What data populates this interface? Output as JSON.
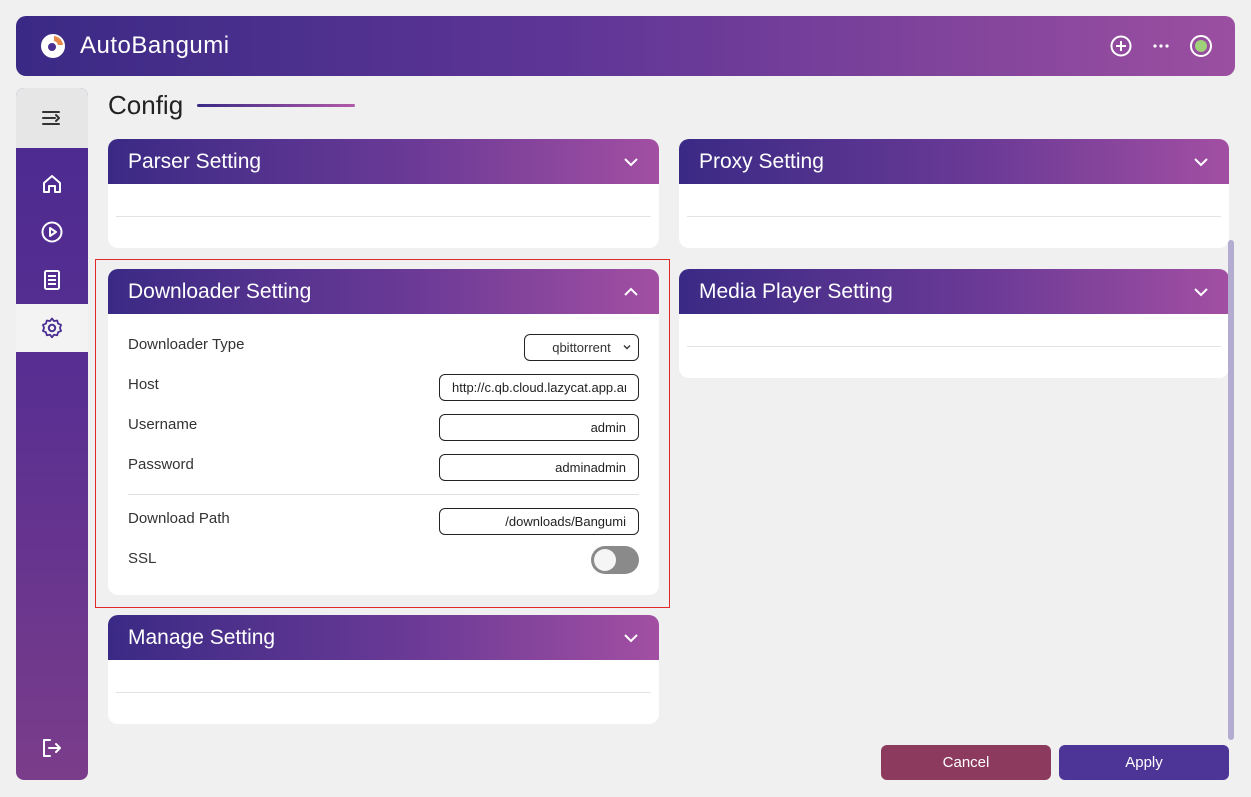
{
  "app": {
    "title": "AutoBangumi"
  },
  "page": {
    "title": "Config"
  },
  "sidebar": {
    "items": [
      {
        "icon": "home-icon",
        "label": "Home"
      },
      {
        "icon": "play-icon",
        "label": "Player"
      },
      {
        "icon": "log-icon",
        "label": "Log"
      },
      {
        "icon": "gear-icon",
        "label": "Config",
        "active": true
      }
    ],
    "logout_icon": "logout-icon"
  },
  "cards": {
    "parser": {
      "title": "Parser Setting"
    },
    "proxy": {
      "title": "Proxy Setting"
    },
    "downloader": {
      "title": "Downloader Setting",
      "fields": {
        "type_label": "Downloader Type",
        "type_value": "qbittorrent",
        "host_label": "Host",
        "host_value": "http://c.qb.cloud.lazycat.app.ar",
        "username_label": "Username",
        "username_value": "admin",
        "password_label": "Password",
        "password_value": "adminadmin",
        "path_label": "Download Path",
        "path_value": "/downloads/Bangumi",
        "ssl_label": "SSL",
        "ssl_on": false
      }
    },
    "media_player": {
      "title": "Media Player Setting"
    },
    "manage": {
      "title": "Manage Setting"
    }
  },
  "actions": {
    "cancel": "Cancel",
    "apply": "Apply"
  },
  "colors": {
    "accent": "#4c3596",
    "cancel": "#8c3a5e",
    "highlight": "#e02a2a"
  }
}
